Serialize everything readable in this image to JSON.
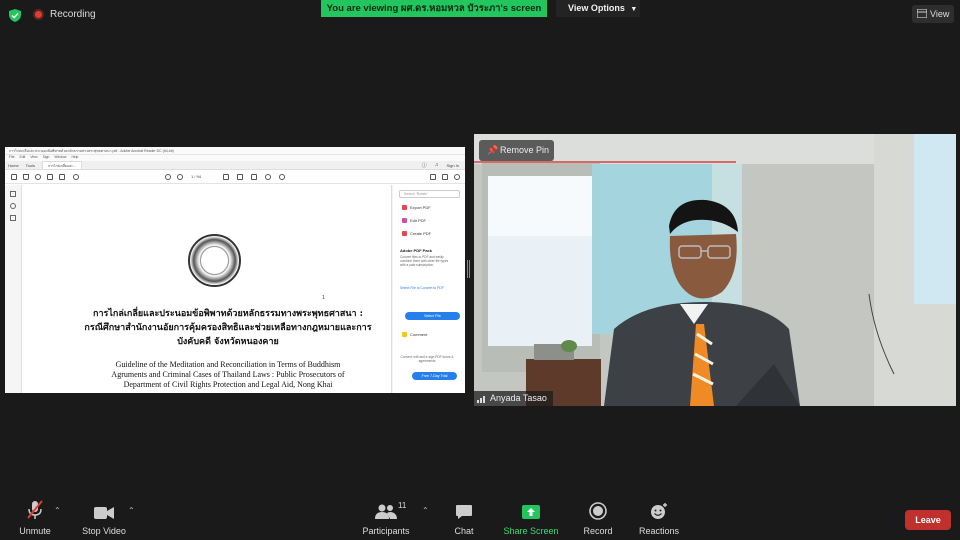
{
  "top": {
    "recording": "Recording",
    "viewing_banner": "You are viewing ผศ.ดร.หอมหวล บัวระภา's screen",
    "view_options": "View Options",
    "view": "View"
  },
  "shared_screen": {
    "window_title": "การไกล่เกลี่ยและประนอมข้อพิพาทด้วยหลักธรรมทางพระพุทธศาสนา.pdf - Adobe Acrobat Reader DC (64-bit)",
    "menu": [
      "File",
      "Edit",
      "View",
      "Sign",
      "Window",
      "Help"
    ],
    "tabs": [
      "Home",
      "Tools"
    ],
    "doc_tab": "การไกล่เกลี่ยและ...",
    "sign_in": "Sign In",
    "thai_title_1": "การไกล่เกลี่ยและประนอมข้อพิพาทด้วยหลักธรรมทางพระพุทธศาสนา :",
    "thai_title_2": "กรณีศึกษาสำนักงานอัยการคุ้มครองสิทธิและช่วยเหลือทางกฎหมายและการ",
    "thai_title_3": "บังคับคดี จังหวัดหนองคาย",
    "english_1": "Guideline of the Meditation and Reconciliation in Terms of Buddhism",
    "english_2": "Agruments and Criminal Cases of Thailand Laws : Public Prosecutors of",
    "english_3": "Department of Civil Rights Protection and Legal Aid, Nong Khai",
    "page_mark": "1",
    "page_info": "1 / 94",
    "right_panel": {
      "search": "Search 'Rotate'",
      "export_pdf": "Export PDF",
      "edit_pdf": "Edit PDF",
      "create_pdf": "Create PDF",
      "pack_title": "Adobe PDF Pack",
      "pack_text": "Convert files to PDF and easily combine them with other file types with a paid subscription.",
      "select_file_link": "Select File to Convert to PDF",
      "select_file_btn": "Select File",
      "comment": "Comment",
      "promo": "Convert, edit and e-sign PDF forms & agreements",
      "trial_btn": "Free 7-Day Trial"
    }
  },
  "camera": {
    "remove_pin": "Remove Pin",
    "name": "Anyada Tasao"
  },
  "controls": {
    "unmute": "Unmute",
    "stop_video": "Stop Video",
    "participants": "Participants",
    "participants_count": "11",
    "chat": "Chat",
    "share_screen": "Share Screen",
    "record": "Record",
    "reactions": "Reactions",
    "leave": "Leave"
  },
  "colors": {
    "accent_green": "#22c55e",
    "leave_red": "#c0312d",
    "background": "#1a1a1a"
  }
}
